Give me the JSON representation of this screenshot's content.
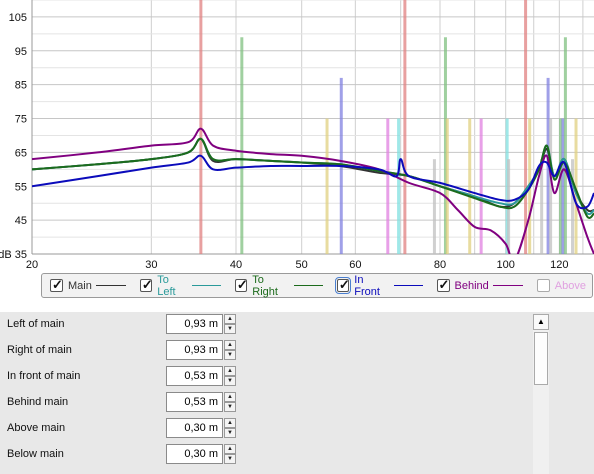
{
  "chart_data": {
    "type": "line",
    "x_scale": "log",
    "xlim": [
      20,
      135
    ],
    "ylim": [
      35,
      110
    ],
    "x_ticks": [
      "20",
      "30",
      "40",
      "50",
      "60",
      "80",
      "100",
      "120"
    ],
    "x_tick_values": [
      20,
      30,
      40,
      50,
      60,
      80,
      100,
      120
    ],
    "y_ticks": [
      "105",
      "95",
      "85",
      "75",
      "65",
      "55",
      "45",
      "dB 35"
    ],
    "y_tick_values": [
      105,
      95,
      85,
      75,
      65,
      55,
      45,
      35
    ],
    "grid": true,
    "series": [
      {
        "name": "Main",
        "color": "#333333",
        "x": [
          20,
          25,
          30,
          34,
          35.5,
          37,
          40,
          45,
          50,
          57,
          65,
          72,
          80,
          90,
          98,
          103,
          108,
          112,
          115,
          118,
          122,
          127,
          132,
          135
        ],
        "y": [
          60,
          61.5,
          63,
          65,
          69,
          62.5,
          63,
          62.5,
          62,
          61,
          59,
          58,
          55,
          52,
          49,
          50,
          55,
          60,
          66,
          58,
          63,
          53,
          48,
          48
        ]
      },
      {
        "name": "To Left",
        "color": "#2a9a9a",
        "x": [
          20,
          25,
          30,
          34,
          35.5,
          37,
          40,
          45,
          50,
          57,
          65,
          72,
          80,
          90,
          98,
          103,
          108,
          112,
          115,
          118,
          122,
          127,
          132,
          135
        ],
        "y": [
          60,
          61.5,
          63,
          65,
          69,
          63,
          63,
          62.5,
          62,
          61.5,
          59.5,
          58,
          55,
          52,
          50,
          50,
          55,
          60,
          67,
          58,
          63,
          53,
          47,
          48
        ]
      },
      {
        "name": "To Right",
        "color": "#1c6b1c",
        "x": [
          20,
          25,
          30,
          34,
          35.5,
          37,
          40,
          45,
          50,
          57,
          65,
          72,
          80,
          90,
          98,
          103,
          108,
          112,
          115,
          118,
          122,
          127,
          132,
          135
        ],
        "y": [
          60,
          61.5,
          63,
          65,
          69,
          63,
          63,
          62.5,
          62,
          61.5,
          59.5,
          58,
          55,
          51.5,
          49,
          49,
          54,
          60,
          67,
          57,
          62,
          54,
          46,
          47
        ]
      },
      {
        "name": "In Front",
        "color": "#0b0bbb",
        "x": [
          20,
          25,
          30,
          34,
          35.5,
          37,
          40,
          45,
          50,
          57,
          65,
          69,
          70,
          72,
          80,
          90,
          98,
          103,
          108,
          112,
          115,
          118,
          122,
          127,
          132,
          135
        ],
        "y": [
          55,
          58,
          60.5,
          62,
          64,
          60,
          60.5,
          61,
          61,
          61,
          60,
          58,
          63,
          58,
          56,
          53,
          51,
          51,
          54,
          61,
          62,
          58,
          62,
          50,
          49,
          53
        ]
      },
      {
        "name": "Behind",
        "color": "#800080",
        "x": [
          20,
          25,
          30,
          34,
          35.5,
          37,
          40,
          45,
          50,
          57,
          65,
          72,
          80,
          85,
          90,
          95,
          100,
          103,
          108,
          112,
          115,
          118,
          122,
          127,
          132,
          135
        ],
        "y": [
          63,
          65,
          67,
          68,
          72,
          67,
          65.5,
          64.5,
          64,
          62.5,
          60,
          56,
          53,
          48,
          43,
          42,
          38,
          33,
          45,
          58,
          64,
          53,
          60,
          50,
          40,
          35
        ]
      }
    ],
    "markers": [
      {
        "x": 35.5,
        "color": "#e08080",
        "top": 110
      },
      {
        "x": 40.8,
        "color": "#80c080",
        "top": 99
      },
      {
        "x": 54.5,
        "color": "#e0d080",
        "top": 75
      },
      {
        "x": 57.2,
        "color": "#8080e0",
        "top": 87
      },
      {
        "x": 67,
        "color": "#e080e0",
        "top": 75
      },
      {
        "x": 69.5,
        "color": "#80e0e0",
        "top": 75
      },
      {
        "x": 71,
        "color": "#e08080",
        "top": 110
      },
      {
        "x": 78.5,
        "color": "#c0c0c0",
        "top": 63
      },
      {
        "x": 81.5,
        "color": "#80c080",
        "top": 99
      },
      {
        "x": 82,
        "color": "#e0d080",
        "top": 75
      },
      {
        "x": 88.5,
        "color": "#e0d080",
        "top": 75
      },
      {
        "x": 92,
        "color": "#e080e0",
        "top": 75
      },
      {
        "x": 100.5,
        "color": "#80e0e0",
        "top": 75
      },
      {
        "x": 101,
        "color": "#c0c0c0",
        "top": 63
      },
      {
        "x": 107,
        "color": "#e08080",
        "top": 110
      },
      {
        "x": 108.5,
        "color": "#e0d080",
        "top": 75
      },
      {
        "x": 113,
        "color": "#c0c0c0",
        "top": 63
      },
      {
        "x": 115.5,
        "color": "#8080e0",
        "top": 87
      },
      {
        "x": 116.5,
        "color": "#c0c0c0",
        "top": 75
      },
      {
        "x": 120.5,
        "color": "#80c080",
        "top": 75
      },
      {
        "x": 121.5,
        "color": "#8080e0",
        "top": 75
      },
      {
        "x": 122.5,
        "color": "#80c080",
        "top": 99
      },
      {
        "x": 125.5,
        "color": "#c0c0c0",
        "top": 63
      },
      {
        "x": 127,
        "color": "#e0d080",
        "top": 75
      }
    ]
  },
  "legend": [
    {
      "label": "Main",
      "checked": true,
      "color": "#333333"
    },
    {
      "label": "To Left",
      "checked": true,
      "color": "#2a9a9a"
    },
    {
      "label": "To Right",
      "checked": true,
      "color": "#1c6b1c"
    },
    {
      "label": "In Front",
      "checked": true,
      "color": "#0b0bbb",
      "focused": true
    },
    {
      "label": "Behind",
      "checked": true,
      "color": "#800080"
    },
    {
      "label": "Above",
      "checked": false,
      "color": "#e0a0e0"
    }
  ],
  "fields": [
    {
      "label": "Left of main",
      "value": "0,93 m"
    },
    {
      "label": "Right of main",
      "value": "0,93 m"
    },
    {
      "label": "In front of main",
      "value": "0,53 m"
    },
    {
      "label": "Behind main",
      "value": "0,53 m"
    },
    {
      "label": "Above main",
      "value": "0,30 m"
    },
    {
      "label": "Below main",
      "value": "0,30 m"
    }
  ],
  "scrollbar": {
    "up_arrow": "▲"
  }
}
